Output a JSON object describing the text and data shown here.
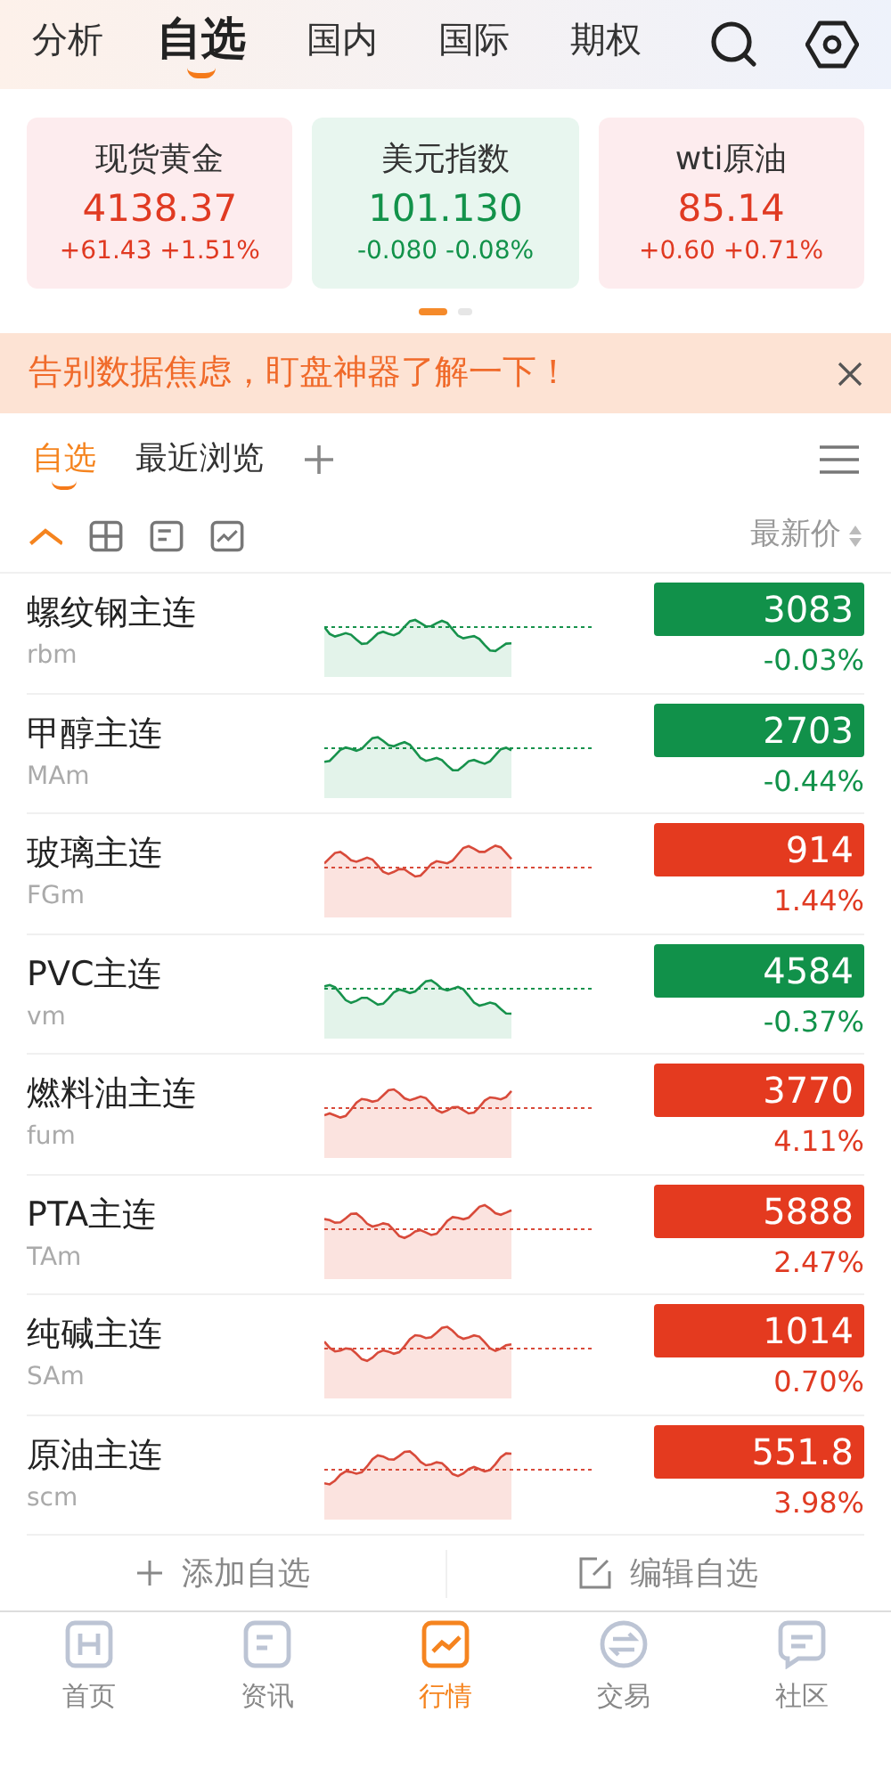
{
  "top_tabs": [
    {
      "label": "分析",
      "selected": false
    },
    {
      "label": "自选",
      "selected": true
    },
    {
      "label": "国内",
      "selected": false
    },
    {
      "label": "国际",
      "selected": false
    },
    {
      "label": "期权",
      "selected": false
    }
  ],
  "cards": [
    {
      "name": "现货黄金",
      "price": "4138.37",
      "change": "+61.43 +1.51%",
      "rising": true
    },
    {
      "name": "美元指数",
      "price": "101.130",
      "change": "-0.080 -0.08%",
      "rising": false
    },
    {
      "name": "wti原油",
      "price": "85.14",
      "change": "+0.60 +0.71%",
      "rising": true
    }
  ],
  "pager": [
    {
      "selected": true
    },
    {
      "selected": false
    }
  ],
  "banner": {
    "text": "告别数据焦虑，盯盘神器了解一下！"
  },
  "sub_tabs": [
    {
      "label": "自选",
      "selected": true
    },
    {
      "label": "最近浏览",
      "selected": false
    }
  ],
  "view_modes": [
    {
      "selected": true
    },
    {
      "selected": false
    },
    {
      "selected": false
    },
    {
      "selected": false
    }
  ],
  "sort_label": "最新价",
  "rows": [
    {
      "name": "螺纹钢主连",
      "code": "rbm",
      "price": "3083",
      "change": "-0.03%",
      "rising": false
    },
    {
      "name": "甲醇主连",
      "code": "MAm",
      "price": "2703",
      "change": "-0.44%",
      "rising": false
    },
    {
      "name": "玻璃主连",
      "code": "FGm",
      "price": "914",
      "change": "1.44%",
      "rising": true
    },
    {
      "name": "PVC主连",
      "code": "vm",
      "price": "4584",
      "change": "-0.37%",
      "rising": false
    },
    {
      "name": "燃料油主连",
      "code": "fum",
      "price": "3770",
      "change": "4.11%",
      "rising": true
    },
    {
      "name": "PTA主连",
      "code": "TAm",
      "price": "5888",
      "change": "2.47%",
      "rising": true
    },
    {
      "name": "纯碱主连",
      "code": "SAm",
      "price": "1014",
      "change": "0.70%",
      "rising": true
    },
    {
      "name": "原油主连",
      "code": "scm",
      "price": "551.8",
      "change": "3.98%",
      "rising": true
    }
  ],
  "actions": [
    "添加自选",
    "编辑自选"
  ],
  "nav": [
    {
      "label": "首页",
      "selected": false
    },
    {
      "label": "资讯",
      "selected": false
    },
    {
      "label": "行情",
      "selected": true
    },
    {
      "label": "交易",
      "selected": false
    },
    {
      "label": "社区",
      "selected": false
    }
  ]
}
